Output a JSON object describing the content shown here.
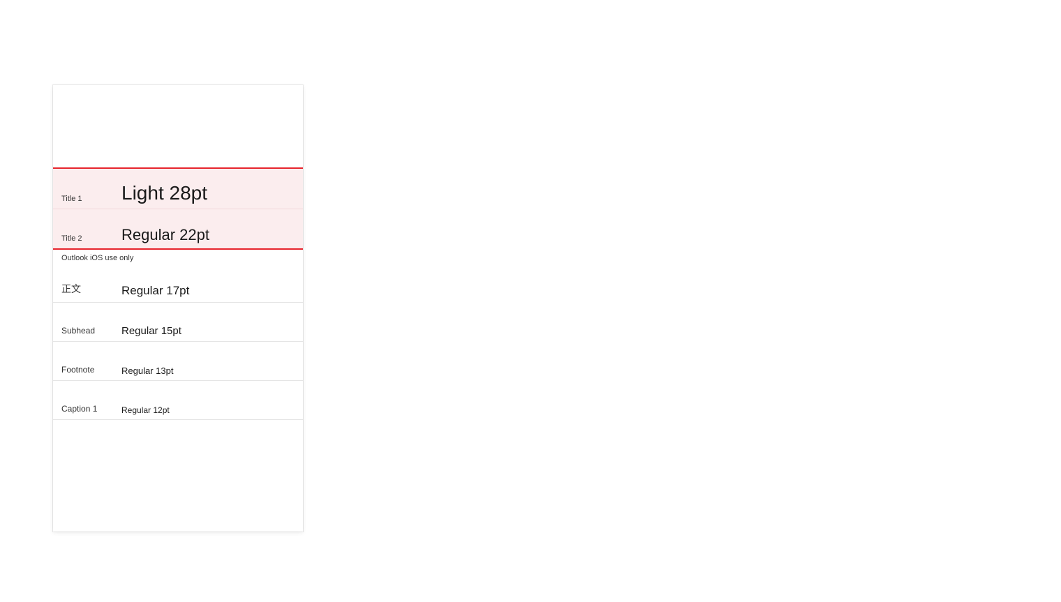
{
  "note": "Outlook iOS use only",
  "rows": {
    "title1": {
      "label": "Title 1",
      "sample": "Light 28pt"
    },
    "title2": {
      "label": "Title 2",
      "sample": "Regular 22pt"
    },
    "body": {
      "label": "正文",
      "sample": "Regular 17pt"
    },
    "subhead": {
      "label": "Subhead",
      "sample": "Regular 15pt"
    },
    "footnote": {
      "label": "Footnote",
      "sample": "Regular 13pt"
    },
    "caption1": {
      "label": "Caption 1",
      "sample": "Regular 12pt"
    }
  }
}
